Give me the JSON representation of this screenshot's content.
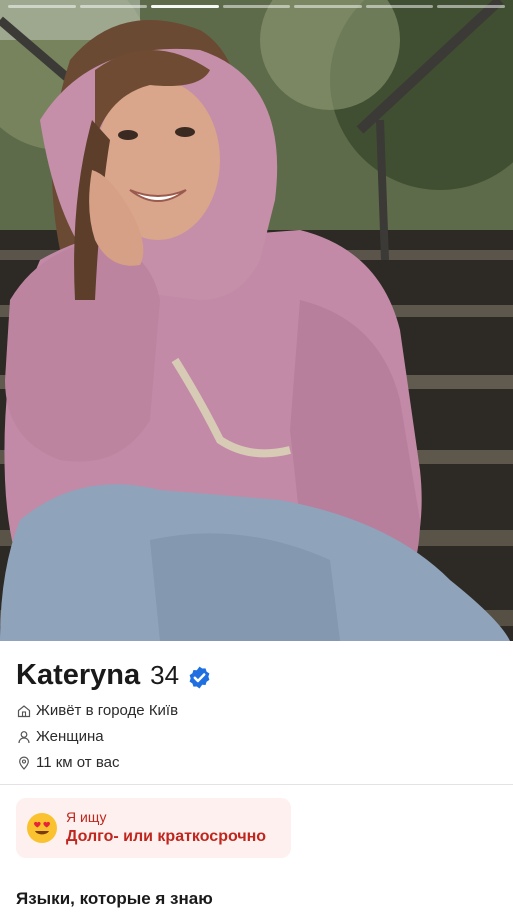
{
  "story": {
    "segments": 7,
    "active_index": 2
  },
  "profile": {
    "name": "Kateryna",
    "age": "34",
    "verified": true,
    "details": {
      "city": "Живёт в городе Київ",
      "gender": "Женщина",
      "distance": "11 км от вас"
    }
  },
  "seeking": {
    "label": "Я ищу",
    "value": "Долго- или краткосрочно",
    "emoji": "heart-eyes"
  },
  "languages": {
    "title": "Языки, которые я знаю"
  },
  "colors": {
    "accent": "#c0261d",
    "seeking_bg": "#fdf0ef",
    "verified_badge": "#1f6fe0"
  }
}
